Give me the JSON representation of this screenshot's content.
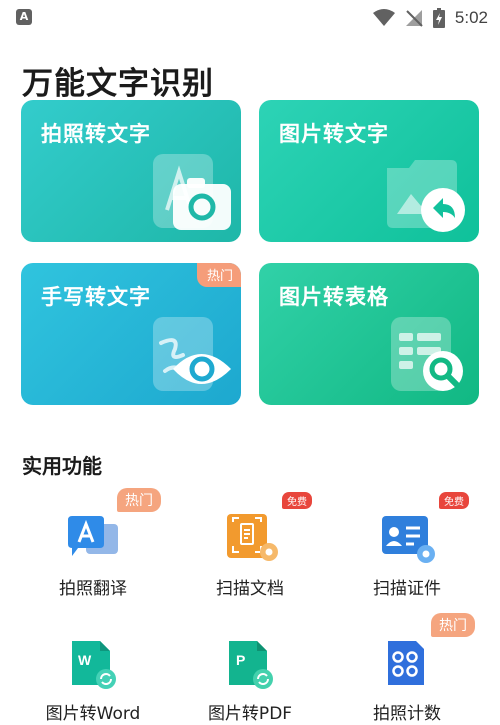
{
  "status_bar": {
    "app_indicator": "A",
    "time": "5:02",
    "icons": [
      "wifi-icon",
      "no-signal-icon",
      "battery-charging-icon"
    ]
  },
  "page": {
    "title": "万能文字识别"
  },
  "cards": [
    {
      "label": "拍照转文字",
      "icon": "photo-text-camera-icon",
      "color_from": "#2ec9c9",
      "color_to": "#1fb8a8"
    },
    {
      "label": "图片转文字",
      "icon": "image-text-reply-icon",
      "color_from": "#2bd3b4",
      "color_to": "#10c19a"
    },
    {
      "label": "手写转文字",
      "icon": "handwriting-eye-icon",
      "color_from": "#2fc2dc",
      "color_to": "#1ea9d0",
      "tag": "热门"
    },
    {
      "label": "图片转表格",
      "icon": "table-search-icon",
      "color_from": "#2fd1a6",
      "color_to": "#12b982"
    }
  ],
  "section": {
    "title": "实用功能"
  },
  "features": [
    {
      "label": "拍照翻译",
      "icon": "translate-icon",
      "badge": "热门",
      "badge_type": "hot"
    },
    {
      "label": "扫描文档",
      "icon": "scan-document-icon",
      "badge": "免费",
      "badge_type": "free"
    },
    {
      "label": "扫描证件",
      "icon": "scan-id-card-icon",
      "badge": "免费",
      "badge_type": "free"
    },
    {
      "label": "图片转Word",
      "icon": "image-to-word-icon"
    },
    {
      "label": "图片转PDF",
      "icon": "image-to-pdf-icon"
    },
    {
      "label": "拍照计数",
      "icon": "photo-count-icon",
      "badge": "热门",
      "badge_type": "hot"
    }
  ]
}
